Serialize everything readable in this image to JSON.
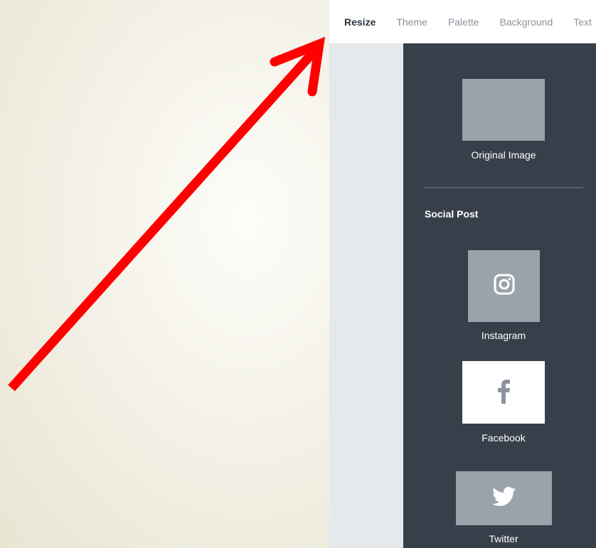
{
  "tabs": [
    {
      "label": "Resize",
      "active": true
    },
    {
      "label": "Theme",
      "active": false
    },
    {
      "label": "Palette",
      "active": false
    },
    {
      "label": "Background",
      "active": false
    },
    {
      "label": "Text",
      "active": false
    }
  ],
  "panel": {
    "original": {
      "label": "Original Image",
      "icon": "image-placeholder"
    },
    "section_title": "Social Post",
    "items": [
      {
        "label": "Instagram",
        "icon": "instagram-icon"
      },
      {
        "label": "Facebook",
        "icon": "facebook-icon"
      },
      {
        "label": "Twitter",
        "icon": "twitter-icon"
      }
    ]
  },
  "colors": {
    "panel_bg": "#373f4a",
    "tile_gray": "#9aa3ab",
    "tile_selected": "#ffffff",
    "arrow": "#ff0000"
  }
}
